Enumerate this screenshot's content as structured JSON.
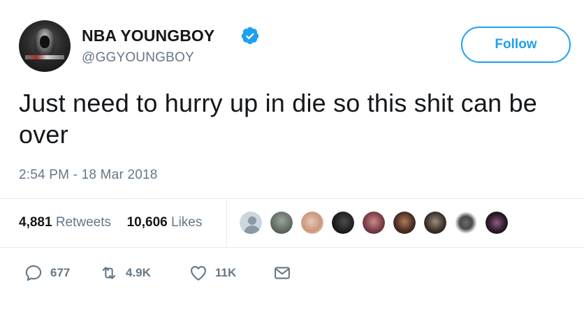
{
  "user": {
    "display_name": "NBA YOUNGBOY",
    "handle": "@GGYOUNGBOY",
    "verified": true
  },
  "follow_button": {
    "label": "Follow"
  },
  "tweet": {
    "text": "Just need to hurry up in die so this shit can be over",
    "timestamp": "2:54 PM - 18 Mar 2018"
  },
  "stats": {
    "retweets_count": "4,881",
    "retweets_label": "Retweets",
    "likes_count": "10,606",
    "likes_label": "Likes"
  },
  "actions": {
    "replies": "677",
    "retweets": "4.9K",
    "likes": "11K"
  },
  "colors": {
    "accent": "#1da1f2",
    "text_primary": "#14171a",
    "text_secondary": "#657786",
    "divider": "#e6ecf0"
  },
  "icons": {
    "verified": "verified-badge-icon",
    "reply": "reply-icon",
    "retweet": "retweet-icon",
    "like": "heart-icon",
    "dm": "envelope-icon"
  }
}
